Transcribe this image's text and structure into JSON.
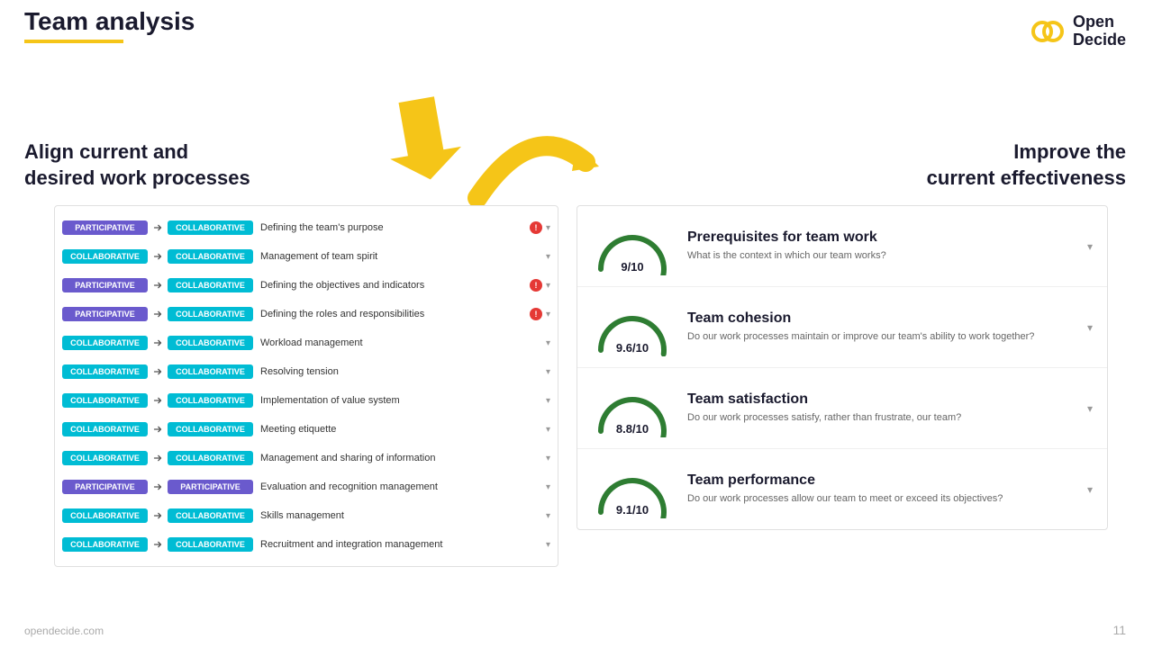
{
  "header": {
    "title": "Team analysis",
    "underline_color": "#f5c518"
  },
  "logo": {
    "text_line1": "Open",
    "text_line2": "Decide",
    "url": "opendecide.com"
  },
  "left_heading": {
    "line1": "Align current and",
    "line2": "desired work processes"
  },
  "right_heading": {
    "line1": "Improve the",
    "line2": "current effectiveness"
  },
  "processes": [
    {
      "badge1": "PARTICIPATIVE",
      "badge1_type": "participative",
      "badge2": "COLLABORATIVE",
      "badge2_type": "collaborative",
      "name": "Defining the team's purpose",
      "alert": true,
      "chevron": true
    },
    {
      "badge1": "COLLABORATIVE",
      "badge1_type": "collaborative",
      "badge2": "COLLABORATIVE",
      "badge2_type": "collaborative",
      "name": "Management of team spirit",
      "alert": false,
      "chevron": true
    },
    {
      "badge1": "PARTICIPATIVE",
      "badge1_type": "participative",
      "badge2": "COLLABORATIVE",
      "badge2_type": "collaborative",
      "name": "Defining the objectives and indicators",
      "alert": true,
      "chevron": true
    },
    {
      "badge1": "PARTICIPATIVE",
      "badge1_type": "participative",
      "badge2": "COLLABORATIVE",
      "badge2_type": "collaborative",
      "name": "Defining the roles and responsibilities",
      "alert": true,
      "chevron": true
    },
    {
      "badge1": "COLLABORATIVE",
      "badge1_type": "collaborative",
      "badge2": "COLLABORATIVE",
      "badge2_type": "collaborative",
      "name": "Workload management",
      "alert": false,
      "chevron": true
    },
    {
      "badge1": "COLLABORATIVE",
      "badge1_type": "collaborative",
      "badge2": "COLLABORATIVE",
      "badge2_type": "collaborative",
      "name": "Resolving tension",
      "alert": false,
      "chevron": true
    },
    {
      "badge1": "COLLABORATIVE",
      "badge1_type": "collaborative",
      "badge2": "COLLABORATIVE",
      "badge2_type": "collaborative",
      "name": "Implementation of value system",
      "alert": false,
      "chevron": true
    },
    {
      "badge1": "COLLABORATIVE",
      "badge1_type": "collaborative",
      "badge2": "COLLABORATIVE",
      "badge2_type": "collaborative",
      "name": "Meeting etiquette",
      "alert": false,
      "chevron": true
    },
    {
      "badge1": "COLLABORATIVE",
      "badge1_type": "collaborative",
      "badge2": "COLLABORATIVE",
      "badge2_type": "collaborative",
      "name": "Management and sharing of information",
      "alert": false,
      "chevron": true
    },
    {
      "badge1": "PARTICIPATIVE",
      "badge1_type": "participative",
      "badge2": "PARTICIPATIVE",
      "badge2_type": "participative",
      "name": "Evaluation and recognition management",
      "alert": false,
      "chevron": true
    },
    {
      "badge1": "COLLABORATIVE",
      "badge1_type": "collaborative",
      "badge2": "COLLABORATIVE",
      "badge2_type": "collaborative",
      "name": "Skills management",
      "alert": false,
      "chevron": true
    },
    {
      "badge1": "COLLABORATIVE",
      "badge1_type": "collaborative",
      "badge2": "COLLABORATIVE",
      "badge2_type": "collaborative",
      "name": "Recruitment and integration management",
      "alert": false,
      "chevron": true
    }
  ],
  "metrics": [
    {
      "id": "prerequisites",
      "title": "Prerequisites for team work",
      "description": "What is the context in which our team works?",
      "score": "9/10",
      "score_value": 9,
      "gauge_color": "#2e7d32",
      "chevron": true
    },
    {
      "id": "cohesion",
      "title": "Team cohesion",
      "description": "Do our work processes maintain or improve our team's ability to work together?",
      "score": "9.6/10",
      "score_value": 9.6,
      "gauge_color": "#2e7d32",
      "chevron": true
    },
    {
      "id": "satisfaction",
      "title": "Team satisfaction",
      "description": "Do our work processes satisfy, rather than frustrate, our team?",
      "score": "8.8/10",
      "score_value": 8.8,
      "gauge_color": "#2e7d32",
      "chevron": true
    },
    {
      "id": "performance",
      "title": "Team performance",
      "description": "Do our work processes allow our team to meet or exceed its objectives?",
      "score": "9.1/10",
      "score_value": 9.1,
      "gauge_color": "#2e7d32",
      "chevron": true
    }
  ],
  "footer": {
    "left": "opendecide.com",
    "right": "11"
  }
}
